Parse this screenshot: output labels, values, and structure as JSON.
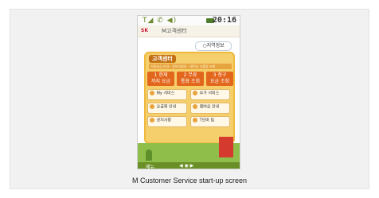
{
  "status_bar": {
    "icons": "T◢ ✆ ◀)",
    "time": "20:16"
  },
  "brand": {
    "logo": "SK",
    "title": "M고객센터"
  },
  "region_button": "○지역정보",
  "panel": {
    "title": "고객센터",
    "sub": "이용요금 안내 · 정보이용료 · 데이터 사용량 조회",
    "quick": [
      {
        "label": "1  현재",
        "sub": "까지 요금"
      },
      {
        "label": "2  무료",
        "sub": "통화 조회"
      },
      {
        "label": "3  청구",
        "sub": "요금 조회"
      }
    ],
    "tiles": [
      {
        "label": "My 서비스"
      },
      {
        "label": "부가 서비스"
      },
      {
        "label": "요금제 안내"
      },
      {
        "label": "멤버십 안내"
      },
      {
        "label": "공지사항"
      },
      {
        "label": "T모바 팁"
      }
    ]
  },
  "bottom_bar": {
    "menu": "메뉴",
    "nav": "◀ ◉ ▶"
  },
  "caption": "M Customer Service start-up screen"
}
